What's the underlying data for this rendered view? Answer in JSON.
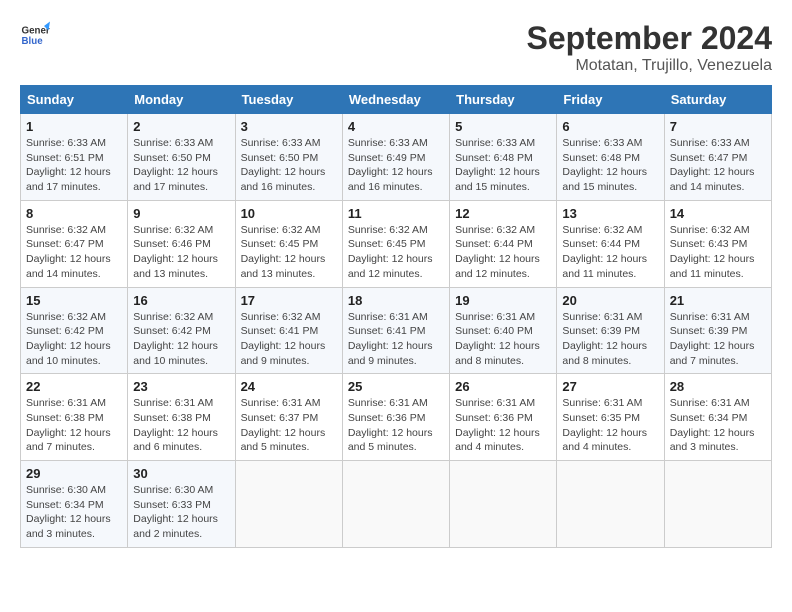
{
  "logo": {
    "line1": "General",
    "line2": "Blue"
  },
  "title": "September 2024",
  "location": "Motatan, Trujillo, Venezuela",
  "headers": [
    "Sunday",
    "Monday",
    "Tuesday",
    "Wednesday",
    "Thursday",
    "Friday",
    "Saturday"
  ],
  "weeks": [
    [
      {
        "day": "1",
        "sunrise": "6:33 AM",
        "sunset": "6:51 PM",
        "daylight": "12 hours and 17 minutes."
      },
      {
        "day": "2",
        "sunrise": "6:33 AM",
        "sunset": "6:50 PM",
        "daylight": "12 hours and 17 minutes."
      },
      {
        "day": "3",
        "sunrise": "6:33 AM",
        "sunset": "6:50 PM",
        "daylight": "12 hours and 16 minutes."
      },
      {
        "day": "4",
        "sunrise": "6:33 AM",
        "sunset": "6:49 PM",
        "daylight": "12 hours and 16 minutes."
      },
      {
        "day": "5",
        "sunrise": "6:33 AM",
        "sunset": "6:48 PM",
        "daylight": "12 hours and 15 minutes."
      },
      {
        "day": "6",
        "sunrise": "6:33 AM",
        "sunset": "6:48 PM",
        "daylight": "12 hours and 15 minutes."
      },
      {
        "day": "7",
        "sunrise": "6:33 AM",
        "sunset": "6:47 PM",
        "daylight": "12 hours and 14 minutes."
      }
    ],
    [
      {
        "day": "8",
        "sunrise": "6:32 AM",
        "sunset": "6:47 PM",
        "daylight": "12 hours and 14 minutes."
      },
      {
        "day": "9",
        "sunrise": "6:32 AM",
        "sunset": "6:46 PM",
        "daylight": "12 hours and 13 minutes."
      },
      {
        "day": "10",
        "sunrise": "6:32 AM",
        "sunset": "6:45 PM",
        "daylight": "12 hours and 13 minutes."
      },
      {
        "day": "11",
        "sunrise": "6:32 AM",
        "sunset": "6:45 PM",
        "daylight": "12 hours and 12 minutes."
      },
      {
        "day": "12",
        "sunrise": "6:32 AM",
        "sunset": "6:44 PM",
        "daylight": "12 hours and 12 minutes."
      },
      {
        "day": "13",
        "sunrise": "6:32 AM",
        "sunset": "6:44 PM",
        "daylight": "12 hours and 11 minutes."
      },
      {
        "day": "14",
        "sunrise": "6:32 AM",
        "sunset": "6:43 PM",
        "daylight": "12 hours and 11 minutes."
      }
    ],
    [
      {
        "day": "15",
        "sunrise": "6:32 AM",
        "sunset": "6:42 PM",
        "daylight": "12 hours and 10 minutes."
      },
      {
        "day": "16",
        "sunrise": "6:32 AM",
        "sunset": "6:42 PM",
        "daylight": "12 hours and 10 minutes."
      },
      {
        "day": "17",
        "sunrise": "6:32 AM",
        "sunset": "6:41 PM",
        "daylight": "12 hours and 9 minutes."
      },
      {
        "day": "18",
        "sunrise": "6:31 AM",
        "sunset": "6:41 PM",
        "daylight": "12 hours and 9 minutes."
      },
      {
        "day": "19",
        "sunrise": "6:31 AM",
        "sunset": "6:40 PM",
        "daylight": "12 hours and 8 minutes."
      },
      {
        "day": "20",
        "sunrise": "6:31 AM",
        "sunset": "6:39 PM",
        "daylight": "12 hours and 8 minutes."
      },
      {
        "day": "21",
        "sunrise": "6:31 AM",
        "sunset": "6:39 PM",
        "daylight": "12 hours and 7 minutes."
      }
    ],
    [
      {
        "day": "22",
        "sunrise": "6:31 AM",
        "sunset": "6:38 PM",
        "daylight": "12 hours and 7 minutes."
      },
      {
        "day": "23",
        "sunrise": "6:31 AM",
        "sunset": "6:38 PM",
        "daylight": "12 hours and 6 minutes."
      },
      {
        "day": "24",
        "sunrise": "6:31 AM",
        "sunset": "6:37 PM",
        "daylight": "12 hours and 5 minutes."
      },
      {
        "day": "25",
        "sunrise": "6:31 AM",
        "sunset": "6:36 PM",
        "daylight": "12 hours and 5 minutes."
      },
      {
        "day": "26",
        "sunrise": "6:31 AM",
        "sunset": "6:36 PM",
        "daylight": "12 hours and 4 minutes."
      },
      {
        "day": "27",
        "sunrise": "6:31 AM",
        "sunset": "6:35 PM",
        "daylight": "12 hours and 4 minutes."
      },
      {
        "day": "28",
        "sunrise": "6:31 AM",
        "sunset": "6:34 PM",
        "daylight": "12 hours and 3 minutes."
      }
    ],
    [
      {
        "day": "29",
        "sunrise": "6:30 AM",
        "sunset": "6:34 PM",
        "daylight": "12 hours and 3 minutes."
      },
      {
        "day": "30",
        "sunrise": "6:30 AM",
        "sunset": "6:33 PM",
        "daylight": "12 hours and 2 minutes."
      },
      {
        "day": "",
        "sunrise": "",
        "sunset": "",
        "daylight": ""
      },
      {
        "day": "",
        "sunrise": "",
        "sunset": "",
        "daylight": ""
      },
      {
        "day": "",
        "sunrise": "",
        "sunset": "",
        "daylight": ""
      },
      {
        "day": "",
        "sunrise": "",
        "sunset": "",
        "daylight": ""
      },
      {
        "day": "",
        "sunrise": "",
        "sunset": "",
        "daylight": ""
      }
    ]
  ]
}
